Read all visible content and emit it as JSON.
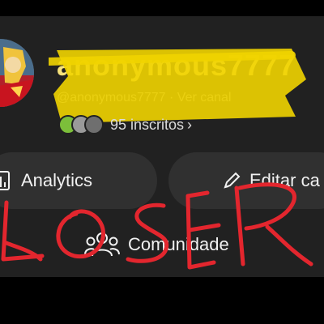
{
  "channel": {
    "name": "anonymous7777",
    "handle": "@anonymous7777 · Ver canal",
    "subscribers_label": "95 inscritos"
  },
  "actions": {
    "analytics_label": "Analytics",
    "edit_label": "Editar ca",
    "community_label": "Comunidade"
  },
  "overlay": {
    "scribble_text": "LOSER"
  },
  "colors": {
    "panel": "#212121",
    "button": "#303030",
    "scribble_yellow": "#f1d400",
    "scribble_red": "#e3262e"
  },
  "icons": [
    "analytics-icon",
    "pencil-icon",
    "people-icon",
    "chevron-right-icon"
  ]
}
